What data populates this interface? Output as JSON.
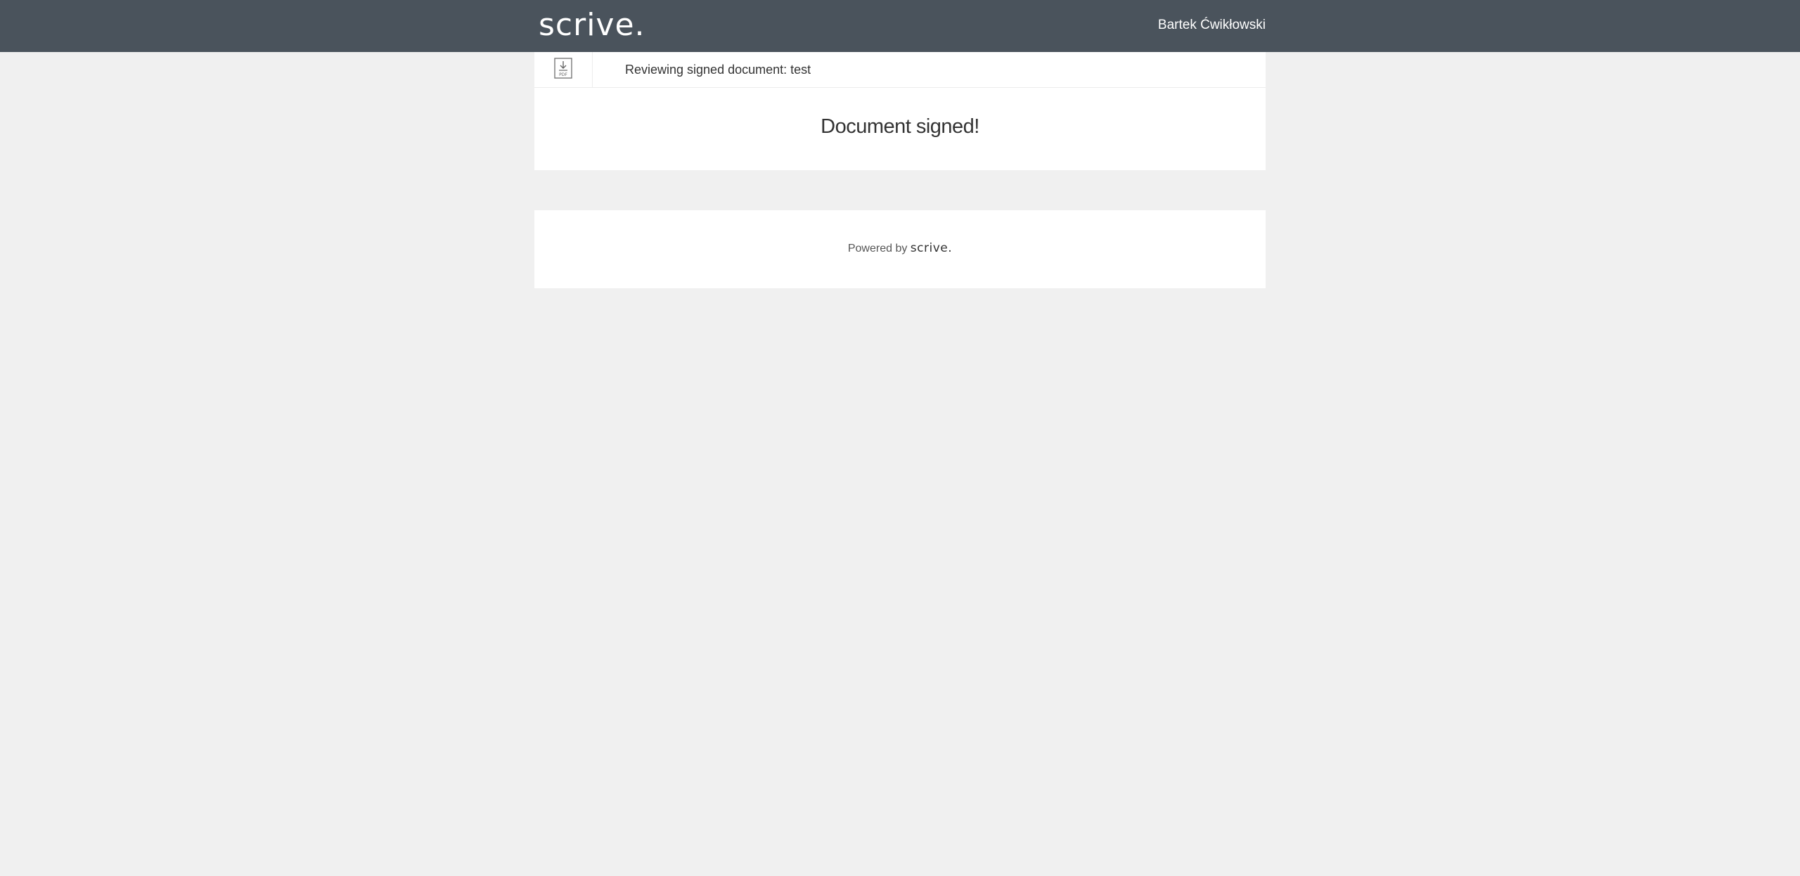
{
  "header": {
    "logo_text": "scrive.",
    "user_name": "Bartek Ćwikłowski"
  },
  "document": {
    "download_icon": "download-pdf-icon",
    "download_icon_label": "PDF",
    "title": "Reviewing signed document: test",
    "status_message": "Document signed!"
  },
  "footer": {
    "powered_by": "Powered by",
    "brand": "scrive."
  },
  "colors": {
    "topbar": "#4a535c",
    "background": "#f0f0f0",
    "card": "#ffffff"
  }
}
